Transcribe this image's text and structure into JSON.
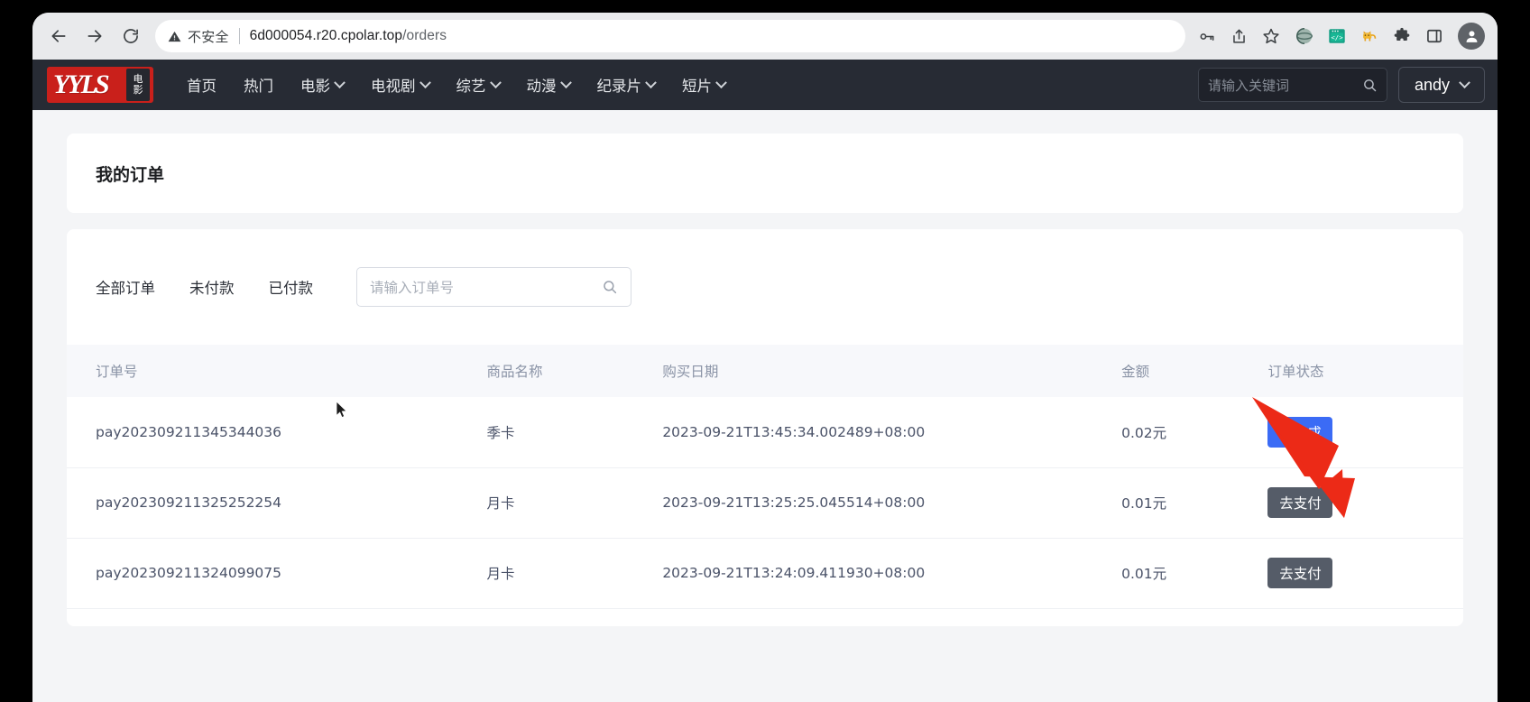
{
  "browser": {
    "back_icon": "back-arrow-icon",
    "forward_icon": "forward-arrow-icon",
    "reload_icon": "reload-icon",
    "security_label": "不安全",
    "url_host": "6d000054.r20.cpolar.top",
    "url_path": "/orders",
    "icons": {
      "key": "key-icon",
      "share": "share-icon",
      "bookmark": "star-icon",
      "ext_sphere": "sphere-extension-icon",
      "ext_code": "code-extension-icon",
      "ext_cat": "cat-extension-icon",
      "ext_puzzle": "puzzle-extension-icon",
      "sidepanel": "side-panel-icon",
      "profile": "profile-avatar-icon"
    }
  },
  "site_header": {
    "logo_mark": "YYLS",
    "logo_sub_line1": "电",
    "logo_sub_line2": "影",
    "nav": [
      {
        "label": "首页",
        "has_caret": false
      },
      {
        "label": "热门",
        "has_caret": false
      },
      {
        "label": "电影",
        "has_caret": true
      },
      {
        "label": "电视剧",
        "has_caret": true
      },
      {
        "label": "综艺",
        "has_caret": true
      },
      {
        "label": "动漫",
        "has_caret": true
      },
      {
        "label": "纪录片",
        "has_caret": true
      },
      {
        "label": "短片",
        "has_caret": true
      }
    ],
    "search_placeholder": "请输入关键词",
    "search_icon": "search-icon",
    "user_name": "andy",
    "user_caret_icon": "chevron-down-icon"
  },
  "page": {
    "title": "我的订单"
  },
  "filters": {
    "tabs": [
      "全部订单",
      "未付款",
      "已付款"
    ],
    "active_tab": "全部订单",
    "search_placeholder": "请输入订单号",
    "search_icon": "search-icon"
  },
  "table": {
    "columns": [
      "订单号",
      "商品名称",
      "购买日期",
      "金额",
      "订单状态"
    ],
    "rows": [
      {
        "order_id": "pay202309211345344036",
        "product": "季卡",
        "date": "2023-09-21T13:45:34.002489+08:00",
        "amount": "0.02元",
        "status_label": "已完成",
        "status_kind": "done"
      },
      {
        "order_id": "pay202309211325252254",
        "product": "月卡",
        "date": "2023-09-21T13:25:25.045514+08:00",
        "amount": "0.01元",
        "status_label": "去支付",
        "status_kind": "pay"
      },
      {
        "order_id": "pay202309211324099075",
        "product": "月卡",
        "date": "2023-09-21T13:24:09.411930+08:00",
        "amount": "0.01元",
        "status_label": "去支付",
        "status_kind": "pay"
      }
    ]
  },
  "overlays": {
    "arrow_color": "#ec2a17",
    "arrow_name": "red-annotation-arrow",
    "cursor_name": "mouse-cursor"
  },
  "colors": {
    "brand_red": "#c9201b",
    "header_dark": "#272b34",
    "status_done": "#3b6bf5",
    "status_pay": "#555c68",
    "page_bg": "#f4f5f7"
  }
}
